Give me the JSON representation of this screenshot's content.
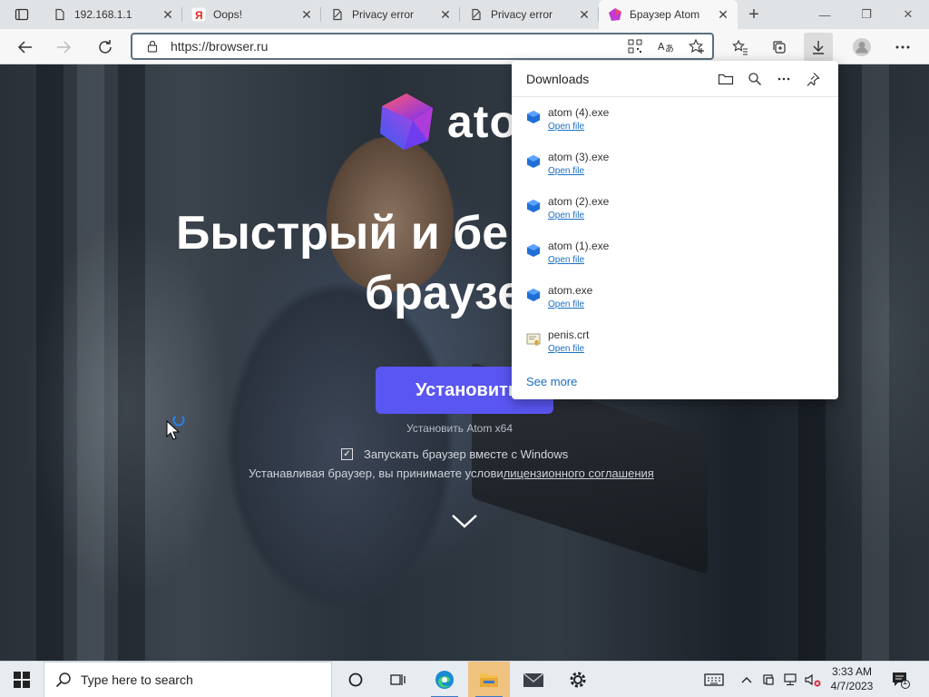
{
  "tabs": [
    {
      "title": "192.168.1.1",
      "icon": "page-icon",
      "active": false
    },
    {
      "title": "Oops!",
      "icon": "yandex-icon",
      "active": false
    },
    {
      "title": "Privacy error",
      "icon": "privacy-error-icon",
      "active": false
    },
    {
      "title": "Privacy error",
      "icon": "privacy-error-icon",
      "active": false
    },
    {
      "title": "Браузер Atom",
      "icon": "atom-icon",
      "active": true
    }
  ],
  "address_bar": {
    "url": "https://browser.ru"
  },
  "page": {
    "brand_name": "atom",
    "headline_line1": "Быстрый и бе",
    "headline_line2": "браузе",
    "install_button": "Установить",
    "install_sub": "Установить Atom x64",
    "launch_checkbox_label": "Запускать браузер вместе с Windows",
    "license_text": "Устанавливая браузер, вы принимаете услови",
    "license_link": "лицензионного соглашения"
  },
  "downloads": {
    "title": "Downloads",
    "items": [
      {
        "name": "atom (4).exe",
        "action": "Open file",
        "icon": "exe-icon"
      },
      {
        "name": "atom (3).exe",
        "action": "Open file",
        "icon": "exe-icon"
      },
      {
        "name": "atom (2).exe",
        "action": "Open file",
        "icon": "exe-icon"
      },
      {
        "name": "atom (1).exe",
        "action": "Open file",
        "icon": "exe-icon"
      },
      {
        "name": "atom.exe",
        "action": "Open file",
        "icon": "exe-icon"
      },
      {
        "name": "penis.crt",
        "action": "Open file",
        "icon": "certificate-icon"
      }
    ],
    "see_more": "See more"
  },
  "taskbar": {
    "search_placeholder": "Type here to search",
    "clock_time": "3:33 AM",
    "clock_date": "4/7/2023",
    "notification_count": "1"
  },
  "colors": {
    "accent": "#5a56f2",
    "link": "#1a6fc2",
    "taskbar": "#e7ecf1"
  }
}
